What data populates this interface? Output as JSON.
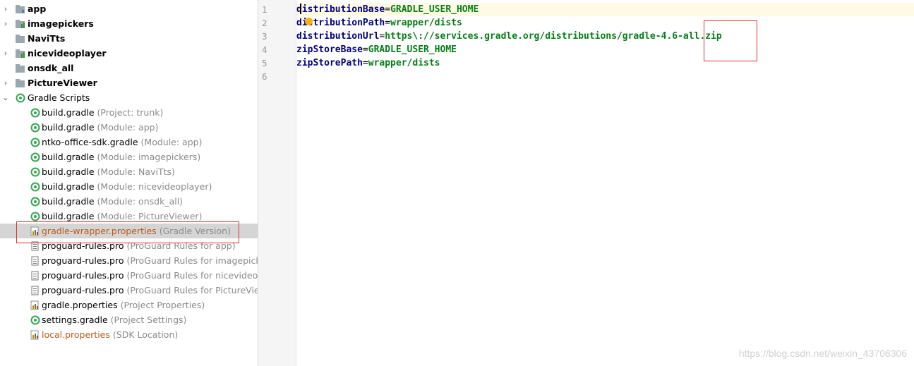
{
  "project_tree": {
    "modules": [
      {
        "label": "app"
      },
      {
        "label": "imagepickers"
      },
      {
        "label": "NaviTts"
      },
      {
        "label": "nicevideoplayer"
      },
      {
        "label": "onsdk_all"
      },
      {
        "label": "PictureViewer"
      }
    ],
    "scripts_group": {
      "label": "Gradle Scripts"
    },
    "scripts": [
      {
        "name": "build.gradle",
        "hint": "(Project: trunk)",
        "icon": "gradle-icon"
      },
      {
        "name": "build.gradle",
        "hint": "(Module: app)",
        "icon": "gradle-icon"
      },
      {
        "name": "ntko-office-sdk.gradle",
        "hint": "(Module: app)",
        "icon": "gradle-icon"
      },
      {
        "name": "build.gradle",
        "hint": "(Module: imagepickers)",
        "icon": "gradle-icon"
      },
      {
        "name": "build.gradle",
        "hint": "(Module: NaviTts)",
        "icon": "gradle-icon"
      },
      {
        "name": "build.gradle",
        "hint": "(Module: nicevideoplayer)",
        "icon": "gradle-icon"
      },
      {
        "name": "build.gradle",
        "hint": "(Module: onsdk_all)",
        "icon": "gradle-icon"
      },
      {
        "name": "build.gradle",
        "hint": "(Module: PictureViewer)",
        "icon": "gradle-icon"
      },
      {
        "name": "gradle-wrapper.properties",
        "hint": "(Gradle Version)",
        "icon": "properties-icon"
      },
      {
        "name": "proguard-rules.pro",
        "hint": "(ProGuard Rules for app)",
        "icon": "text-file-icon"
      },
      {
        "name": "proguard-rules.pro",
        "hint": "(ProGuard Rules for imagepicker",
        "icon": "text-file-icon"
      },
      {
        "name": "proguard-rules.pro",
        "hint": "(ProGuard Rules for nicevideopla",
        "icon": "text-file-icon"
      },
      {
        "name": "proguard-rules.pro",
        "hint": "(ProGuard Rules for PictureViewe",
        "icon": "text-file-icon"
      },
      {
        "name": "gradle.properties",
        "hint": "(Project Properties)",
        "icon": "properties-icon"
      },
      {
        "name": "settings.gradle",
        "hint": "(Project Settings)",
        "icon": "gradle-icon"
      },
      {
        "name": "local.properties",
        "hint": "(SDK Location)",
        "icon": "properties-icon"
      }
    ]
  },
  "editor": {
    "line_numbers": [
      "1",
      "2",
      "3",
      "4",
      "5",
      "6"
    ],
    "lines": [
      {
        "key": "distributionBase",
        "eq": "=",
        "value": "GRADLE_USER_HOME"
      },
      {
        "key": "distributionPath",
        "eq": "=",
        "value": "wrapper/dists"
      },
      {
        "key": "distributionUrl",
        "eq": "=",
        "value": "https\\://services.gradle.org/distributions/gradle-4.6-all.zip"
      },
      {
        "key": "zipStoreBase",
        "eq": "=",
        "value": "GRADLE_USER_HOME"
      },
      {
        "key": "zipStorePath",
        "eq": "=",
        "value": "wrapper/dists"
      },
      {
        "key": "",
        "eq": "",
        "value": ""
      }
    ]
  },
  "watermark": "https://blog.csdn.net/weixin_43706306",
  "colors": {
    "selection_bg": "#d5d5d5",
    "current_line_bg": "#fffae3",
    "annotation_red": "#e0312e",
    "key_navy": "#000080",
    "value_green": "#067d17",
    "gradle_green": "#33a852",
    "modified_orange": "#b9591b"
  }
}
